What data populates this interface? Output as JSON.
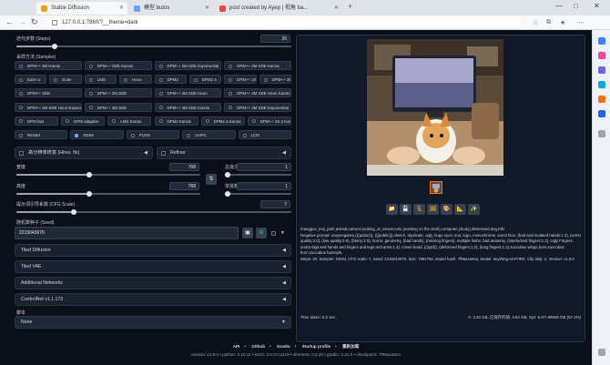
{
  "browser": {
    "tabs": [
      {
        "label": "Stable Diffusion",
        "active": true
      },
      {
        "label": "模型 butos",
        "active": false
      },
      {
        "label": "post created by Ayep | 视角 ba...",
        "active": false
      }
    ],
    "new_tab_icon": "plus-icon",
    "url": "127.0.0.1:7860/?__theme=dark",
    "window_controls": [
      "—",
      "□",
      "✕"
    ],
    "nav_icons": [
      "back-icon",
      "forward-icon",
      "refresh-icon"
    ]
  },
  "left": {
    "steps": {
      "label": "迭代步数 (Steps)",
      "value": "20",
      "fraction": 0.13
    },
    "sampler_label": "采样方法 (Sampler)",
    "sampler_rows": [
      [
        "DPM++ 2M Karras",
        "DPM++ SDE Karras",
        "DPM++ 2M SDE Exponential",
        "DPM++ 2M SDE Karras"
      ],
      [
        "Euler a",
        "Euler",
        "LMS",
        "Heun",
        "DPM2",
        "DPM2 a",
        "DPM++ 2S a",
        "DPM++ 2M"
      ],
      [
        "DPM++ SDE",
        "DPM++ 2M SDE",
        "DPM++ 2M SDE Heun",
        "DPM++ 2M SDE Heun Karras"
      ],
      [
        "DPM++ 2M SDE Heun Exponential",
        "DPM++ 3M SDE",
        "DPM++ 3M SDE Karras",
        "DPM++ 3M SDE Exponential"
      ],
      [
        "DPM fast",
        "DPM adaptive",
        "LMS Karras",
        "DPM2 Karras",
        "DPM2 a Karras",
        "DPM++ 2S a Karras"
      ],
      [
        "Restart",
        "DDIM",
        "PLMS",
        "UniPC",
        "LCM"
      ]
    ],
    "sampler_selected": "DDIM",
    "hires_label": "高分辨率修复 (Hires. fix)",
    "refiner_label": "Refiner",
    "width": {
      "label": "宽度",
      "value": "768",
      "fraction": 0.38
    },
    "height": {
      "label": "高度",
      "value": "768",
      "fraction": 0.38
    },
    "swap_icon": "swap-icon",
    "batch_count": {
      "label": "总批次数",
      "value": "1"
    },
    "batch_size": {
      "label": "单批数量",
      "value": "1"
    },
    "cfg": {
      "label": "提示词引导系数 (CFG Scale)",
      "value": "7",
      "fraction": 0.2
    },
    "seed": {
      "label": "随机数种子 (Seed)",
      "value": "2215043676"
    },
    "seed_icons": [
      "dice-icon",
      "recycle-icon"
    ],
    "accordions": [
      "Tiled Diffusion",
      "Tiled VAE",
      "Additional Networks",
      "ControlNet v1.1.173"
    ],
    "script_label": "脚本",
    "script_value": "None"
  },
  "right": {
    "toolbar_icons": [
      "folder-icon",
      "save-icon",
      "zip-icon",
      "image-icon",
      "paint-icon",
      "chart-icon",
      "sparkle-icon"
    ],
    "info": "mangguo_keji_park,animal,cartoon,looking_at_viewer,solo,(working on the desk),computer,(study),distressed,dog,Kiki",
    "negative": "Negative prompt: easynegative,(((pubic))), (((public))),sketch, duplicate, ugly, huge eyes, text, logo, monochrome, worst face, (bad and mutated hands:1.3), (worst quality:2.0), (low quality:2.0), (blurry:2.0), horror, geometry, (bad hands), (missing fingers), multiple limbs, bad anatomy, (interlocked fingers:1.2), Ugly Fingers, (extra digit and hands and fingers and legs and arms:1.4), crown braid, ((2girl)), (deformed fingers:1.2), (long fingers:1.2),succubus wings,horn,succubus horn,succubus hairstyle,",
    "params": "Steps: 20, Sampler: DDIM, CFG scale: 7, Seed: 2215043676, Size: 768x768, Model hash: 7f96a1a9ca, Model: anything-v5-PrtRE, Clip skip: 2, Version: v1.8.0",
    "time": "Time taken: 6.2 sec.",
    "vram": "A: 3.20 GB, 已保存的值: 3.84 GB, Sys: 5.6/7.99609 GB (57.2%)"
  },
  "footer": {
    "links": [
      "API",
      "Github",
      "Gradio",
      "Startup profile",
      "重新加载"
    ],
    "version": "version: v1.8.0  •  python: 3.10.11  •  torch: 2.0.0+cu118  •  xformers: 0.0.20  •  gradio: 3.41.2  •  checkpoint: 7f96a1a9ca"
  },
  "sidebar_icons": [
    "search-icon",
    "bag-icon",
    "person-icon",
    "globe-icon",
    "office-icon",
    "outlook-icon",
    "plus-icon",
    "settings-icon"
  ],
  "colors": {
    "bg": "#0b0f19",
    "panel": "#111827",
    "accent": "#3b82f6"
  }
}
